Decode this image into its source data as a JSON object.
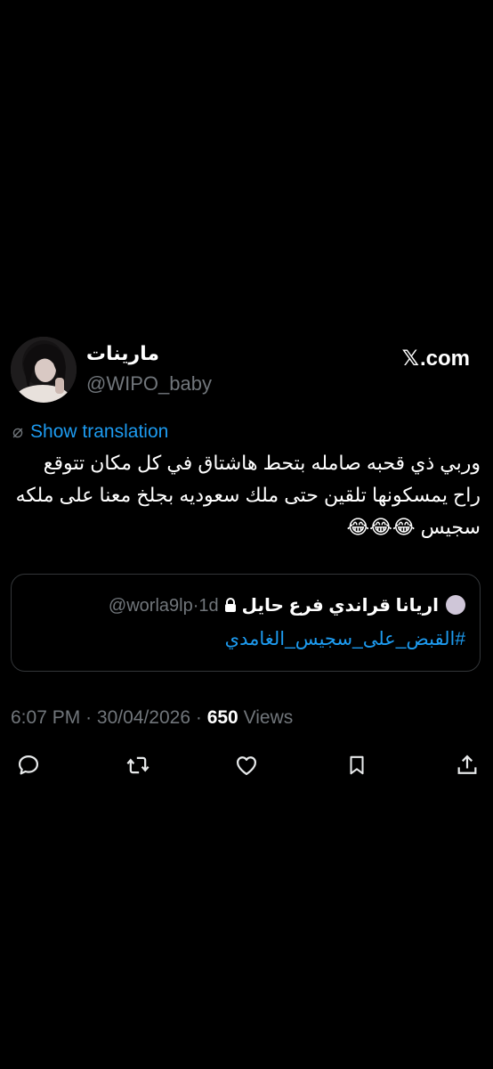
{
  "post": {
    "display_name": "مارينات",
    "handle": "@WIPO_baby",
    "brand": "X.com",
    "brand_mark": "𝕏",
    "brand_suffix": ".com",
    "show_translation": "Show translation",
    "text": "وربي ذي قحبه صامله بتحط هاشتاق في كل مكان تتوقع راح يمسكونها تلقين حتى ملك سعوديه بجلخ معنا على ملكه سجيس 😂😂😂",
    "time": "6:07 PM",
    "date": "30/04/2026",
    "separator": "·",
    "views_count": "650",
    "views_label": "Views"
  },
  "quote": {
    "name": "اريانا قراندي فرع حايل",
    "handle": "@worla9lp",
    "separator": "·",
    "time": "1d",
    "text": "#القبض_على_سجيس_الغامدي"
  },
  "icons": {
    "globe": "translate-globe-icon",
    "lock": "lock-icon",
    "reply": "reply-icon",
    "repost": "repost-icon",
    "like": "like-icon",
    "bookmark": "bookmark-icon",
    "share": "share-icon"
  },
  "colors": {
    "background": "#000000",
    "text": "#ffffff",
    "secondary": "#71767b",
    "link": "#1d9bf0",
    "border": "#333639"
  }
}
